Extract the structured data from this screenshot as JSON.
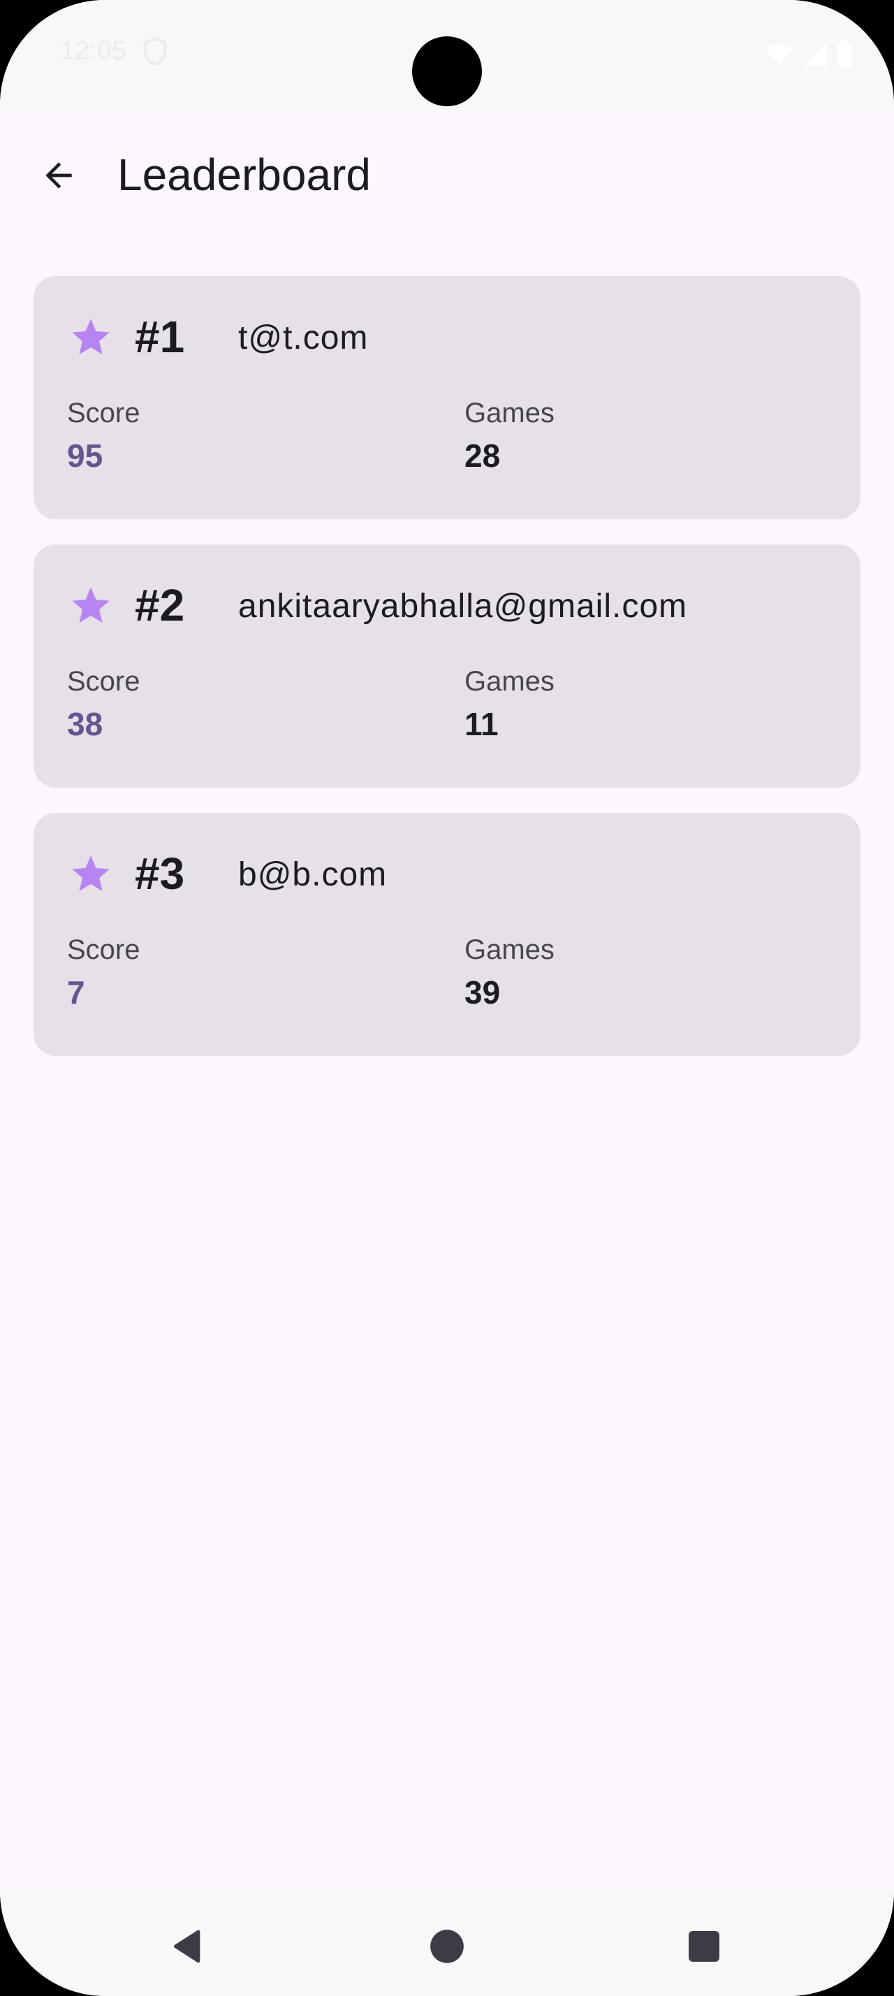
{
  "status_bar": {
    "time": "12:05"
  },
  "app_bar": {
    "title": "Leaderboard",
    "back_icon": "arrow-back-icon"
  },
  "leaderboard": {
    "entries": [
      {
        "rank": "#1",
        "email": "t@t.com",
        "score_label": "Score",
        "score": "95",
        "games_label": "Games",
        "games": "28"
      },
      {
        "rank": "#2",
        "email": "ankitaaryabhalla@gmail.com",
        "score_label": "Score",
        "score": "38",
        "games_label": "Games",
        "games": "11"
      },
      {
        "rank": "#3",
        "email": "b@b.com",
        "score_label": "Score",
        "score": "7",
        "games_label": "Games",
        "games": "39"
      }
    ]
  },
  "colors": {
    "background": "#fcf6fd",
    "card": "#e6e0e8",
    "accent": "#65558f",
    "star": "#b784f2",
    "text": "#1d1b20"
  },
  "nav_bar": {
    "icons": [
      "back-triangle-icon",
      "home-circle-icon",
      "recents-square-icon"
    ]
  }
}
